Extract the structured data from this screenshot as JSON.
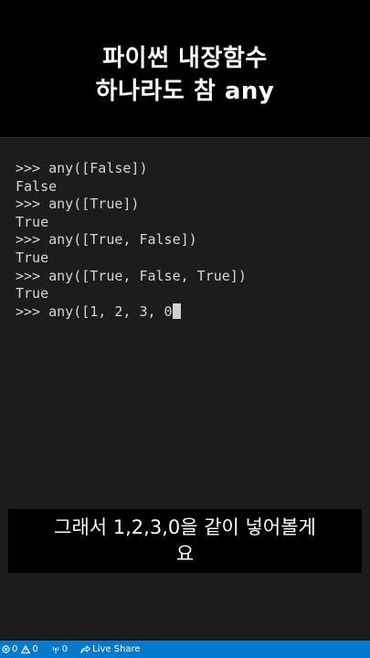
{
  "headline": {
    "line1": "파이썬 내장함수",
    "line2": "하나라도 참 any"
  },
  "terminal": {
    "lines": [
      ">>> any([False])",
      "False",
      ">>> any([True])",
      "True",
      ">>> any([True, False])",
      "True",
      ">>> any([True, False, True])",
      "True",
      ">>> any([1, 2, 3, 0"
    ]
  },
  "subtitle": {
    "line1": "그래서 1,2,3,0을 같이 넣어볼게",
    "line2": "요"
  },
  "statusbar": {
    "errors": "0",
    "warnings": "0",
    "ports": "0",
    "live_share": "Live Share",
    "icons": [
      "error-icon",
      "warning-icon",
      "broadcast-icon",
      "live-share-icon"
    ]
  },
  "colors": {
    "statusbar": "#007acc",
    "terminal_bg": "#1c1c1d",
    "terminal_text": "#d6d6d6"
  }
}
